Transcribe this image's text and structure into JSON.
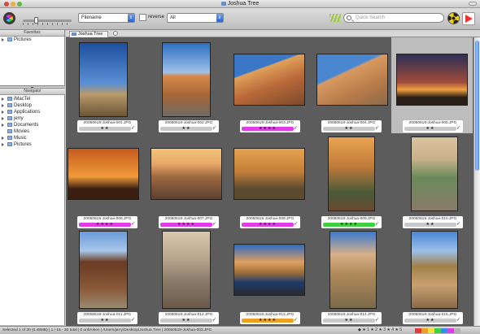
{
  "window": {
    "title": "Joshua Tree"
  },
  "toolbar": {
    "sort_field": "Filename",
    "reverse_label": "reverse",
    "filter_value": "All",
    "search_placeholder": "Quick Search"
  },
  "sidebar": {
    "favorites_title": "Favorites",
    "favorites": [
      {
        "label": "Pictures"
      }
    ],
    "navigator_title": "Navigator",
    "navigator": [
      {
        "label": "iMacTel"
      },
      {
        "label": "Desktop"
      },
      {
        "label": "Applications"
      },
      {
        "label": "jerry"
      },
      {
        "label": "Documents"
      },
      {
        "label": "Movies"
      },
      {
        "label": "Music"
      },
      {
        "label": "Pictures"
      }
    ]
  },
  "tab": {
    "label": "Joshua Tree"
  },
  "colors": {
    "label_magenta": "#e23be8",
    "label_green": "#3ed23e",
    "label_orange": "#f0a020",
    "selection_bg": "#bdbdbd",
    "grid_bg": "#5c5c5c"
  },
  "photos": [
    {
      "filename": "20050518-Joshua-001.JPG",
      "rating": "★★",
      "label_color": ""
    },
    {
      "filename": "20050518-Joshua-002.JPG",
      "rating": "★★",
      "label_color": ""
    },
    {
      "filename": "20050518-Joshua-003.JPG",
      "rating": "★★★★",
      "label_color": "#e23be8"
    },
    {
      "filename": "20050518-Joshua-004.JPG",
      "rating": "★★",
      "label_color": ""
    },
    {
      "filename": "20050518-Joshua-005.JPG",
      "rating": "★★",
      "label_color": ""
    },
    {
      "filename": "20050518-Joshua-006.JPG",
      "rating": "★★★★",
      "label_color": "#e23be8"
    },
    {
      "filename": "20050518-Joshua-007.JPG",
      "rating": "★★★★",
      "label_color": "#e23be8"
    },
    {
      "filename": "20050518-Joshua-008.JPG",
      "rating": "★★★★",
      "label_color": "#e23be8"
    },
    {
      "filename": "20050518-Joshua-009.JPG",
      "rating": "★★★★",
      "label_color": "#3ed23e"
    },
    {
      "filename": "20050518-Joshua-010.JPG",
      "rating": "★★",
      "label_color": ""
    },
    {
      "filename": "20050518-Joshua-011.JPG",
      "rating": "★★",
      "label_color": ""
    },
    {
      "filename": "20050518-Joshua-012.JPG",
      "rating": "★★",
      "label_color": ""
    },
    {
      "filename": "20050518-Joshua-013.JPG",
      "rating": "★★★★",
      "label_color": "#f0a020"
    },
    {
      "filename": "20050518-Joshua-014.JPG",
      "rating": "★★",
      "label_color": ""
    },
    {
      "filename": "20050518-Joshua-015.JPG",
      "rating": "★★",
      "label_color": ""
    }
  ],
  "status": {
    "text": "Selected 1 of 30 (0.48MB) | 1 / 15 - 30 total | 0 unbroken | /Users/jerry/Desktop/Joshua Tree | 20050518-Joshua-003.JPG",
    "filters": "◆ ★ 1 ★ 2 ★ 3 ★ 4 ★ 5"
  }
}
